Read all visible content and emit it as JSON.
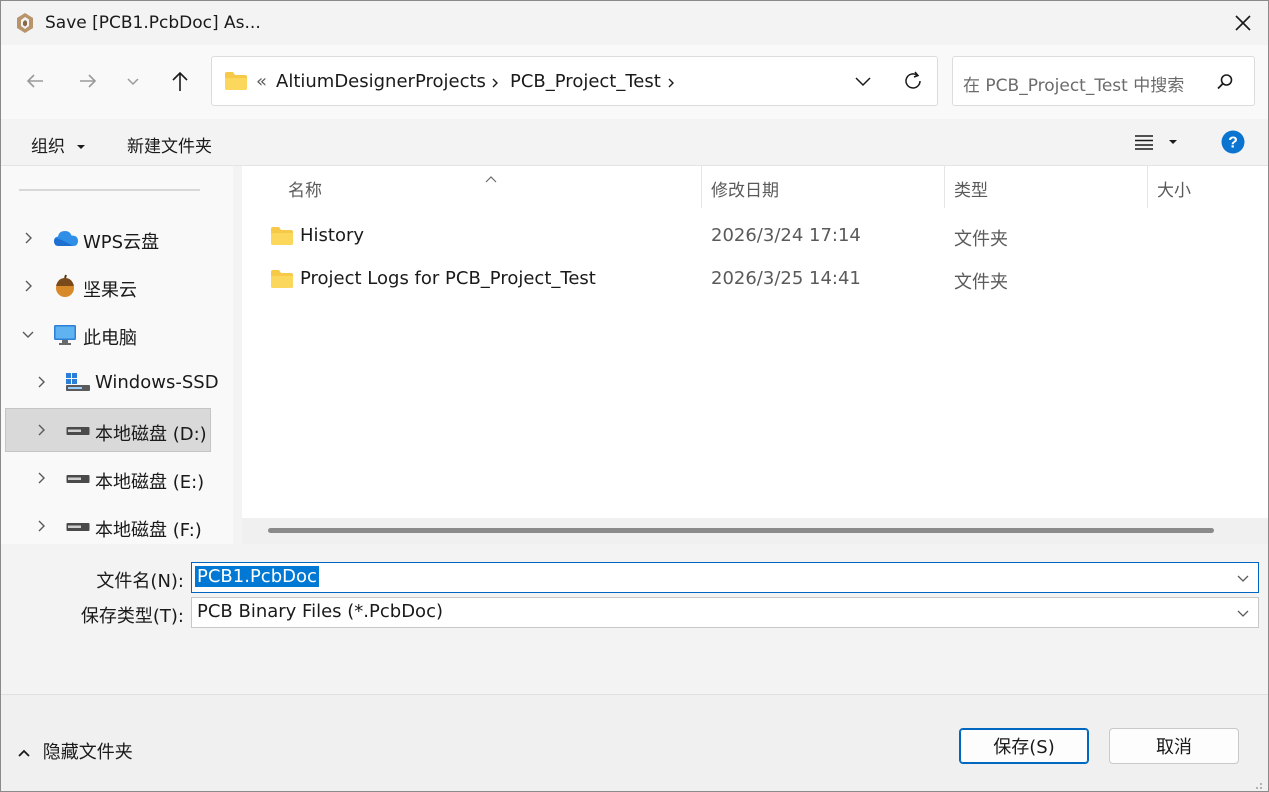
{
  "window": {
    "title": "Save [PCB1.PcbDoc] As..."
  },
  "nav": {
    "breadcrumb_overflow": "«",
    "breadcrumbs": [
      "AltiumDesignerProjects",
      "PCB_Project_Test"
    ],
    "search_placeholder": "在 PCB_Project_Test 中搜索"
  },
  "toolbar": {
    "organize_label": "组织",
    "new_folder_label": "新建文件夹"
  },
  "sidebar": {
    "items": [
      {
        "label": "WPS云盘",
        "icon": "cloud-icon",
        "expanded": false
      },
      {
        "label": "坚果云",
        "icon": "nut-icon",
        "expanded": false
      },
      {
        "label": "此电脑",
        "icon": "computer-icon",
        "expanded": true
      },
      {
        "label": "Windows-SSD",
        "icon": "windows-drive-icon",
        "expanded": false
      },
      {
        "label": "本地磁盘 (D:)",
        "icon": "drive-icon",
        "expanded": false,
        "selected": true
      },
      {
        "label": "本地磁盘 (E:)",
        "icon": "drive-icon",
        "expanded": false
      },
      {
        "label": "本地磁盘 (F:)",
        "icon": "drive-icon",
        "expanded": false
      }
    ]
  },
  "files": {
    "columns": {
      "name": "名称",
      "modified": "修改日期",
      "type": "类型",
      "size": "大小"
    },
    "rows": [
      {
        "name": "History",
        "modified": "2026/3/24 17:14",
        "type": "文件夹"
      },
      {
        "name": "Project Logs for PCB_Project_Test",
        "modified": "2026/3/25 14:41",
        "type": "文件夹"
      }
    ]
  },
  "form": {
    "filename_label": "文件名(N):",
    "filename_value": "PCB1.PcbDoc",
    "filetype_label": "保存类型(T):",
    "filetype_value": "PCB Binary Files (*.PcbDoc)"
  },
  "footer": {
    "hide_folders_label": "隐藏文件夹",
    "save_label": "保存(S)",
    "cancel_label": "取消"
  },
  "colors": {
    "accent": "#0078d4",
    "folder": "#f7c948",
    "help": "#0a74d0"
  }
}
